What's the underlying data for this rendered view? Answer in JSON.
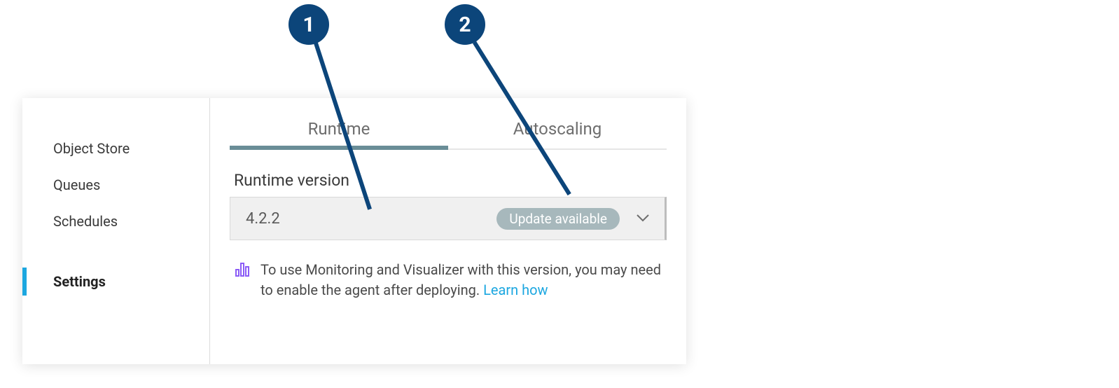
{
  "sidebar": {
    "items": [
      {
        "label": "Object Store",
        "active": false
      },
      {
        "label": "Queues",
        "active": false
      },
      {
        "label": "Schedules",
        "active": false
      },
      {
        "label": "Settings",
        "active": true
      }
    ]
  },
  "tabs": [
    {
      "label": "Runtime",
      "active": true
    },
    {
      "label": "Autoscaling",
      "active": false
    }
  ],
  "runtime": {
    "section_label": "Runtime version",
    "version_value": "4.2.2",
    "update_badge": "Update available",
    "info_text": "To use Monitoring and Visualizer with this version, you may need to enable the agent after deploying. ",
    "learn_link": "Learn how"
  },
  "callouts": {
    "c1": "1",
    "c2": "2"
  }
}
